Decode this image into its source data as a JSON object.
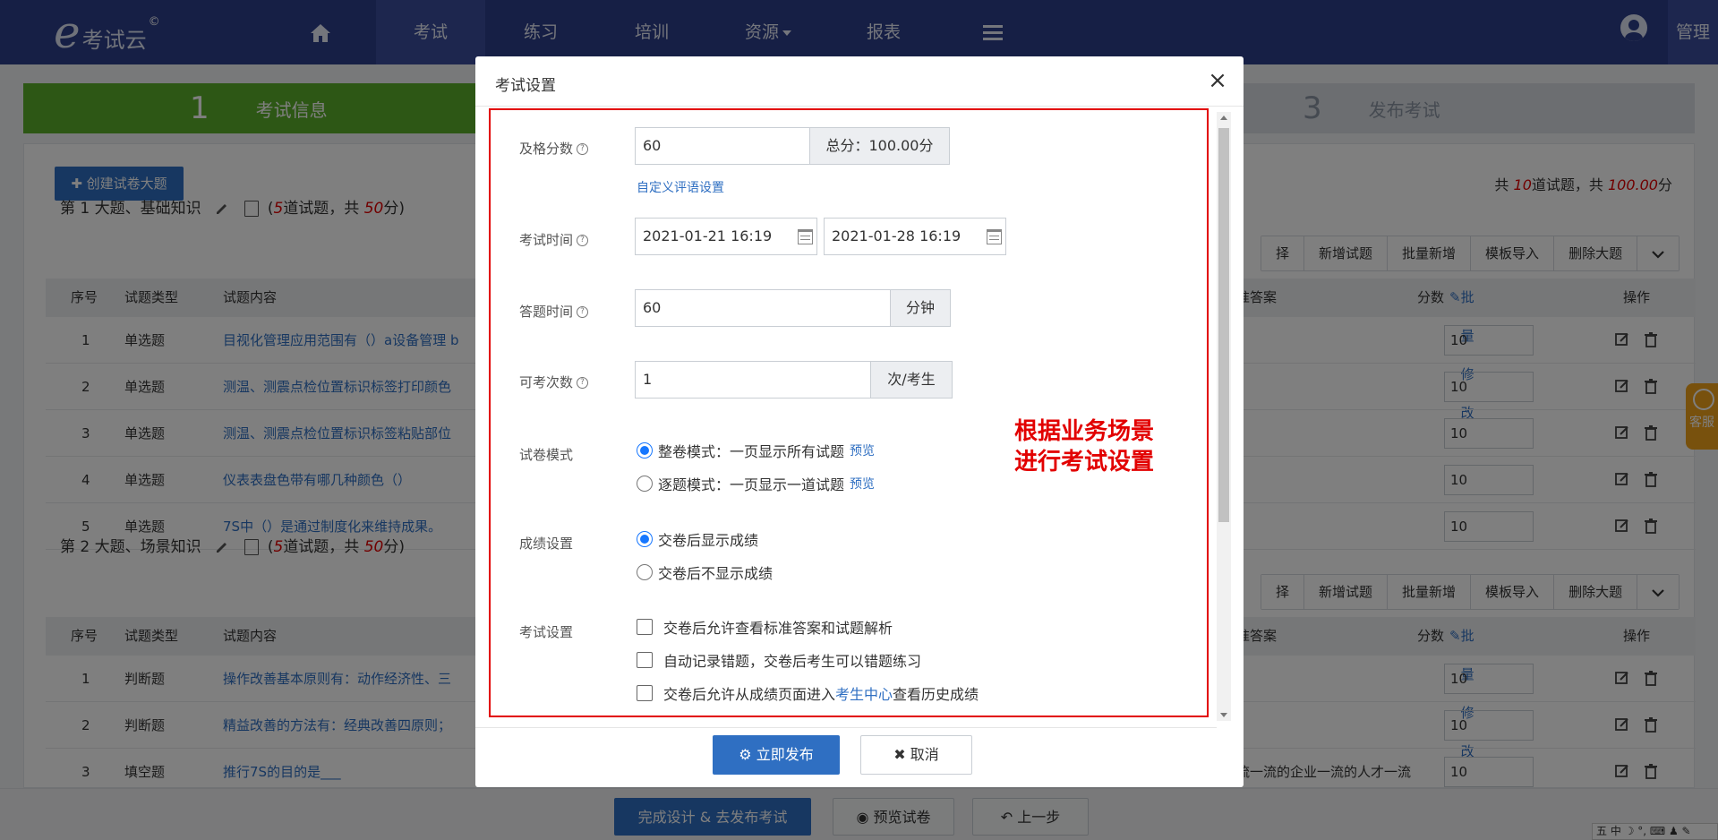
{
  "nav": {
    "logo_text": "考试云",
    "logo_mark": "©",
    "items": [
      "考试",
      "练习",
      "培训",
      "资源",
      "报表"
    ],
    "admin": "管理"
  },
  "steps": [
    {
      "num": "1",
      "label": "考试信息"
    },
    {
      "num": "3",
      "label": "发布考试"
    }
  ],
  "toolbar": {
    "create_label": "创建试卷大题",
    "summary_prefix": "共",
    "summary_count": "10",
    "summary_mid": "道试题，共",
    "summary_score": "100.00",
    "summary_suffix": "分"
  },
  "sections": [
    {
      "title": "第 1 大题、基础知识",
      "meta_open": "(",
      "meta_count": "5",
      "meta_mid": "道试题，共",
      "meta_score": "50",
      "meta_close": "分)",
      "buttons": [
        "择",
        "新增试题",
        "批量新增",
        "模板导入",
        "删除大题"
      ],
      "rows": [
        {
          "no": "1",
          "type": "单选题",
          "content": "目视化管理应用范围有（）a设备管理 b",
          "score": "10"
        },
        {
          "no": "2",
          "type": "单选题",
          "content": "测温、测震点检位置标识标签打印颜色",
          "score": "10"
        },
        {
          "no": "3",
          "type": "单选题",
          "content": "测温、测震点检位置标识标签粘贴部位",
          "score": "10"
        },
        {
          "no": "4",
          "type": "单选题",
          "content": "仪表表盘色带有哪几种颜色（）",
          "score": "10"
        },
        {
          "no": "5",
          "type": "单选题",
          "content": "7S中（）是通过制度化来维持成果。",
          "score": "10"
        }
      ]
    },
    {
      "title": "第 2 大题、场景知识",
      "meta_open": "(",
      "meta_count": "5",
      "meta_mid": "道试题，共",
      "meta_score": "50",
      "meta_close": "分)",
      "buttons": [
        "择",
        "新增试题",
        "批量新增",
        "模板导入",
        "删除大题"
      ],
      "rows": [
        {
          "no": "1",
          "type": "判断题",
          "content": "操作改善基本原则有：动作经济性、三",
          "score": "10"
        },
        {
          "no": "2",
          "type": "判断题",
          "content": "精益改善的方法有：经典改善四原则；",
          "score": "10"
        },
        {
          "no": "3",
          "type": "填空题",
          "content": "推行7S的目的是___",
          "answer": "流一流的企业一流的人才一流",
          "score": "10"
        }
      ]
    }
  ],
  "table_head": {
    "no": "序号",
    "type": "试题类型",
    "content": "试题内容",
    "answer": "准答案",
    "score": "分数",
    "batch_edit": "批量修改",
    "ops": "操作"
  },
  "footer": {
    "finish": "完成设计 & 去发布考试",
    "preview": "预览试卷",
    "back": "上一步"
  },
  "kefu": "客服",
  "tray": "五 中 ☽ °, ⌨ ♟ ✎",
  "modal": {
    "title": "考试设置",
    "pass_label": "及格分数",
    "pass_value": "60",
    "total_score": "总分：100.00分",
    "custom_comment": "自定义评语设置",
    "time_label": "考试时间",
    "start_time": "2021-01-21 16:19",
    "end_time": "2021-01-28 16:19",
    "answer_label": "答题时间",
    "answer_value": "60",
    "answer_unit": "分钟",
    "attempts_label": "可考次数",
    "attempts_value": "1",
    "attempts_unit": "次/考生",
    "mode_label": "试卷模式",
    "mode_full": "整卷模式：一页显示所有试题",
    "mode_single": "逐题模式：一页显示一道试题",
    "preview": "预览",
    "score_label": "成绩设置",
    "score_show": "交卷后显示成绩",
    "score_hide": "交卷后不显示成绩",
    "exam_label": "考试设置",
    "opt1": "交卷后允许查看标准答案和试题解析",
    "opt2": "自动记录错题，交卷后考生可以错题练习",
    "opt3_pre": "交卷后允许从成绩页面进入",
    "opt3_link": "考生中心",
    "opt3_post": "查看历史成绩",
    "annotation_line1": "根据业务场景",
    "annotation_line2": "进行考试设置",
    "publish": "立即发布",
    "cancel": "取消"
  }
}
